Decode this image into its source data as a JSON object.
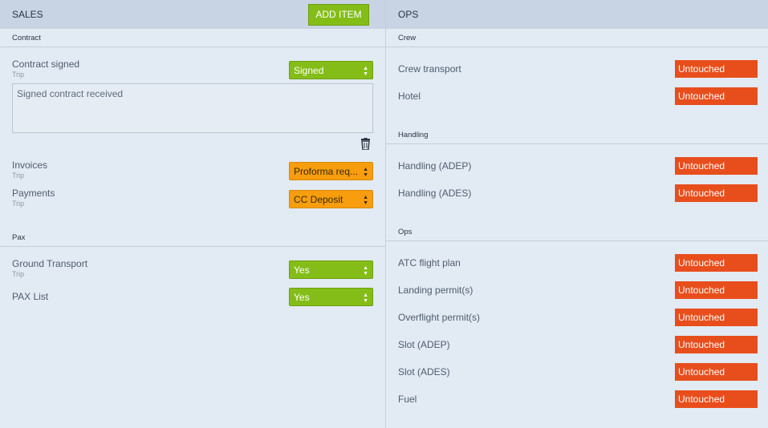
{
  "sales": {
    "title": "SALES",
    "add_button": "ADD ITEM",
    "contract_section": "Contract",
    "contract_signed": {
      "label": "Contract signed",
      "sub": "Trip",
      "value": "Signed"
    },
    "note_text": "Signed contract received",
    "invoices": {
      "label": "Invoices",
      "sub": "Trip",
      "value": "Proforma req..."
    },
    "payments": {
      "label": "Payments",
      "sub": "Trip",
      "value": "CC Deposit"
    },
    "pax_section": "Pax",
    "ground_transport": {
      "label": "Ground Transport",
      "sub": "Trip",
      "value": "Yes"
    },
    "pax_list": {
      "label": "PAX List",
      "value": "Yes"
    }
  },
  "ops": {
    "title": "OPS",
    "crew_section": "Crew",
    "crew_items": [
      {
        "label": "Crew transport",
        "status": "Untouched"
      },
      {
        "label": "Hotel",
        "status": "Untouched"
      }
    ],
    "handling_section": "Handling",
    "handling_items": [
      {
        "label": "Handling (ADEP)",
        "status": "Untouched"
      },
      {
        "label": "Handling (ADES)",
        "status": "Untouched"
      }
    ],
    "ops_section": "Ops",
    "ops_items": [
      {
        "label": "ATC flight plan",
        "status": "Untouched"
      },
      {
        "label": "Landing permit(s)",
        "status": "Untouched"
      },
      {
        "label": "Overflight permit(s)",
        "status": "Untouched"
      },
      {
        "label": "Slot (ADEP)",
        "status": "Untouched"
      },
      {
        "label": "Slot (ADES)",
        "status": "Untouched"
      },
      {
        "label": "Fuel",
        "status": "Untouched"
      }
    ]
  },
  "colors": {
    "green": "#84bd18",
    "orange": "#f79d0e",
    "untouched": "#e84e1c",
    "header": "#c8d4e3"
  }
}
